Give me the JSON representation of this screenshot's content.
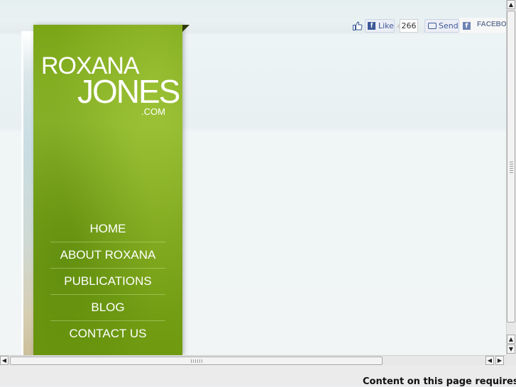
{
  "logo": {
    "line1": "ROXANA",
    "line2": "JONES",
    "line3": ".COM"
  },
  "nav": {
    "items": [
      {
        "label": "HOME"
      },
      {
        "label": "ABOUT ROXANA"
      },
      {
        "label": "PUBLICATIONS"
      },
      {
        "label": "BLOG"
      },
      {
        "label": "CONTACT US"
      }
    ]
  },
  "social": {
    "like_label": "Like",
    "like_count": "266",
    "send_label": "Send",
    "facebook_label": "FACEBOOK"
  },
  "status": {
    "message": "Content on this page requires"
  },
  "colors": {
    "panel_green": "#7ca51b",
    "facebook_blue": "#3b5998"
  },
  "icons": [
    "thumbs-up-icon",
    "facebook-f-icon",
    "send-speech-icon",
    "facebook-square-icon",
    "scroll-arrow-icons"
  ]
}
